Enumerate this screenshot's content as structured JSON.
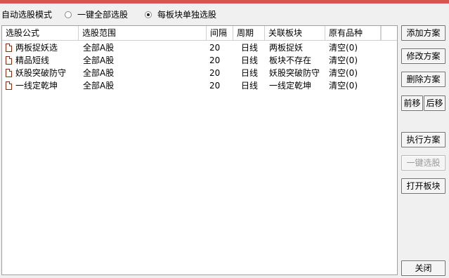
{
  "mode": {
    "label": "自动选股模式",
    "options": [
      {
        "label": "一键全部选股",
        "selected": false
      },
      {
        "label": "每板块单独选股",
        "selected": true
      }
    ]
  },
  "table": {
    "columns": [
      "选股公式",
      "选股范围",
      "间隔",
      "周期",
      "关联板块",
      "原有品种"
    ],
    "rows": [
      {
        "formula": "两板捉妖选",
        "range": "全部A股",
        "interval": "20",
        "period": "日线",
        "sector": "两板捉妖",
        "existing": "清空(0)"
      },
      {
        "formula": "精品短线",
        "range": "全部A股",
        "interval": "20",
        "period": "日线",
        "sector": "板块不存在",
        "existing": "清空(0)"
      },
      {
        "formula": "妖股突破防守",
        "range": "全部A股",
        "interval": "20",
        "period": "日线",
        "sector": "妖股突破防守",
        "existing": "清空(0)"
      },
      {
        "formula": "一线定乾坤",
        "range": "全部A股",
        "interval": "20",
        "period": "日线",
        "sector": "一线定乾坤",
        "existing": "清空(0)"
      }
    ]
  },
  "buttons": {
    "add": "添加方案",
    "modify": "修改方案",
    "delete": "删除方案",
    "move_up": "前移",
    "move_down": "后移",
    "execute": "执行方案",
    "one_click": "一键选股",
    "open_sector": "打开板块",
    "close": "关闭"
  },
  "colors": {
    "accent": "#d9534f",
    "doc_icon": "#8a2a10"
  }
}
